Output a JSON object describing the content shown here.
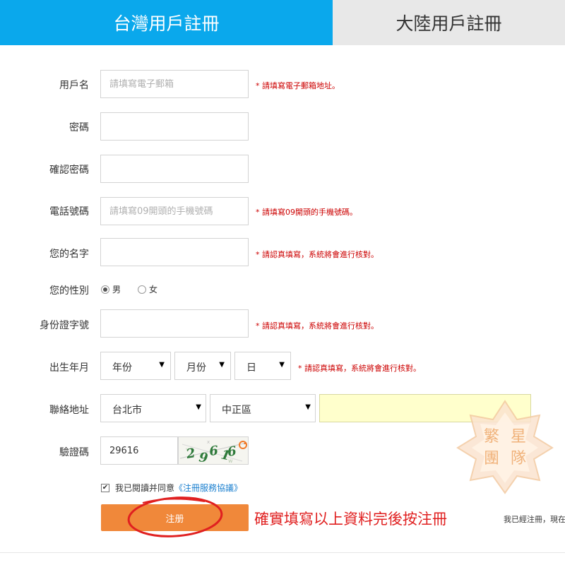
{
  "tabs": [
    {
      "label": "台灣用戶註冊",
      "active": true
    },
    {
      "label": "大陸用戶註冊",
      "active": false
    }
  ],
  "form": {
    "username": {
      "label": "用戶名",
      "placeholder": "請填寫電子郵箱",
      "hint": "* 請填寫電子郵箱地址。"
    },
    "password": {
      "label": "密碼"
    },
    "confirm_password": {
      "label": "確認密碼"
    },
    "phone": {
      "label": "電話號碼",
      "placeholder": "請填寫09開頭的手機號碼",
      "hint": "* 請填寫09開頭的手機號碼。"
    },
    "name": {
      "label": "您的名字",
      "hint": "* 請認真填寫，系統將會進行核對。"
    },
    "gender": {
      "label": "您的性別",
      "options": [
        "男",
        "女"
      ],
      "selected": "男"
    },
    "id_number": {
      "label": "身份證字號",
      "hint": "* 請認真填寫，系統將會進行核對。"
    },
    "birthdate": {
      "label": "出生年月",
      "year": "年份",
      "month": "月份",
      "day": "日",
      "hint": "* 請認真填寫，系統將會進行核對。"
    },
    "address": {
      "label": "聯絡地址",
      "city": "台北市",
      "district": "中正區",
      "detail": ""
    },
    "captcha": {
      "label": "驗證碼",
      "value": "29616",
      "image_text": "29616"
    },
    "agreement": {
      "checked": true,
      "text": "我已閱讀并同意",
      "link_text": "《注冊服務協議》"
    },
    "submit_label": "注册"
  },
  "annotation": "確實填寫以上資料完後按注冊",
  "footer_text": "我已經注冊，現在",
  "watermark_text": [
    "繁",
    "星",
    "團",
    "隊"
  ],
  "colors": {
    "tab_active": "#0aa8ec",
    "submit": "#f0883a",
    "hint": "#cc0000",
    "annotation": "#e02020",
    "link": "#1a7fcf"
  }
}
